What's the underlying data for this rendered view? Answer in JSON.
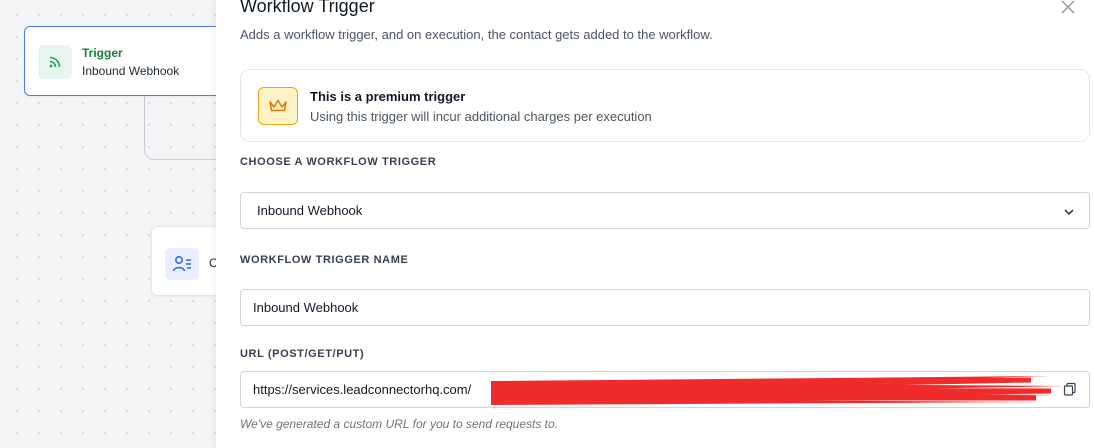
{
  "canvas": {
    "trigger_node": {
      "label": "Trigger",
      "name": "Inbound Webhook"
    },
    "action_node": {
      "label": "C"
    }
  },
  "drawer": {
    "title": "Workflow Trigger",
    "subtitle": "Adds a workflow trigger, and on execution, the contact gets added to the workflow.",
    "premium": {
      "title": "This is a premium trigger",
      "description": "Using this trigger will incur additional charges per execution"
    },
    "choose_trigger": {
      "label": "CHOOSE A WORKFLOW TRIGGER",
      "selected": "Inbound Webhook"
    },
    "trigger_name": {
      "label": "WORKFLOW TRIGGER NAME",
      "value": "Inbound Webhook"
    },
    "url": {
      "label": "URL (POST/GET/PUT)",
      "value": "https://services.leadconnectorhq.com/",
      "helper": "We've generated a custom URL for you to send requests to."
    }
  },
  "colors": {
    "accent_blue": "#4f7cf6",
    "trigger_green": "#15803d",
    "premium_amber": "#f59e0b",
    "redaction_red": "#ef2b2b"
  }
}
